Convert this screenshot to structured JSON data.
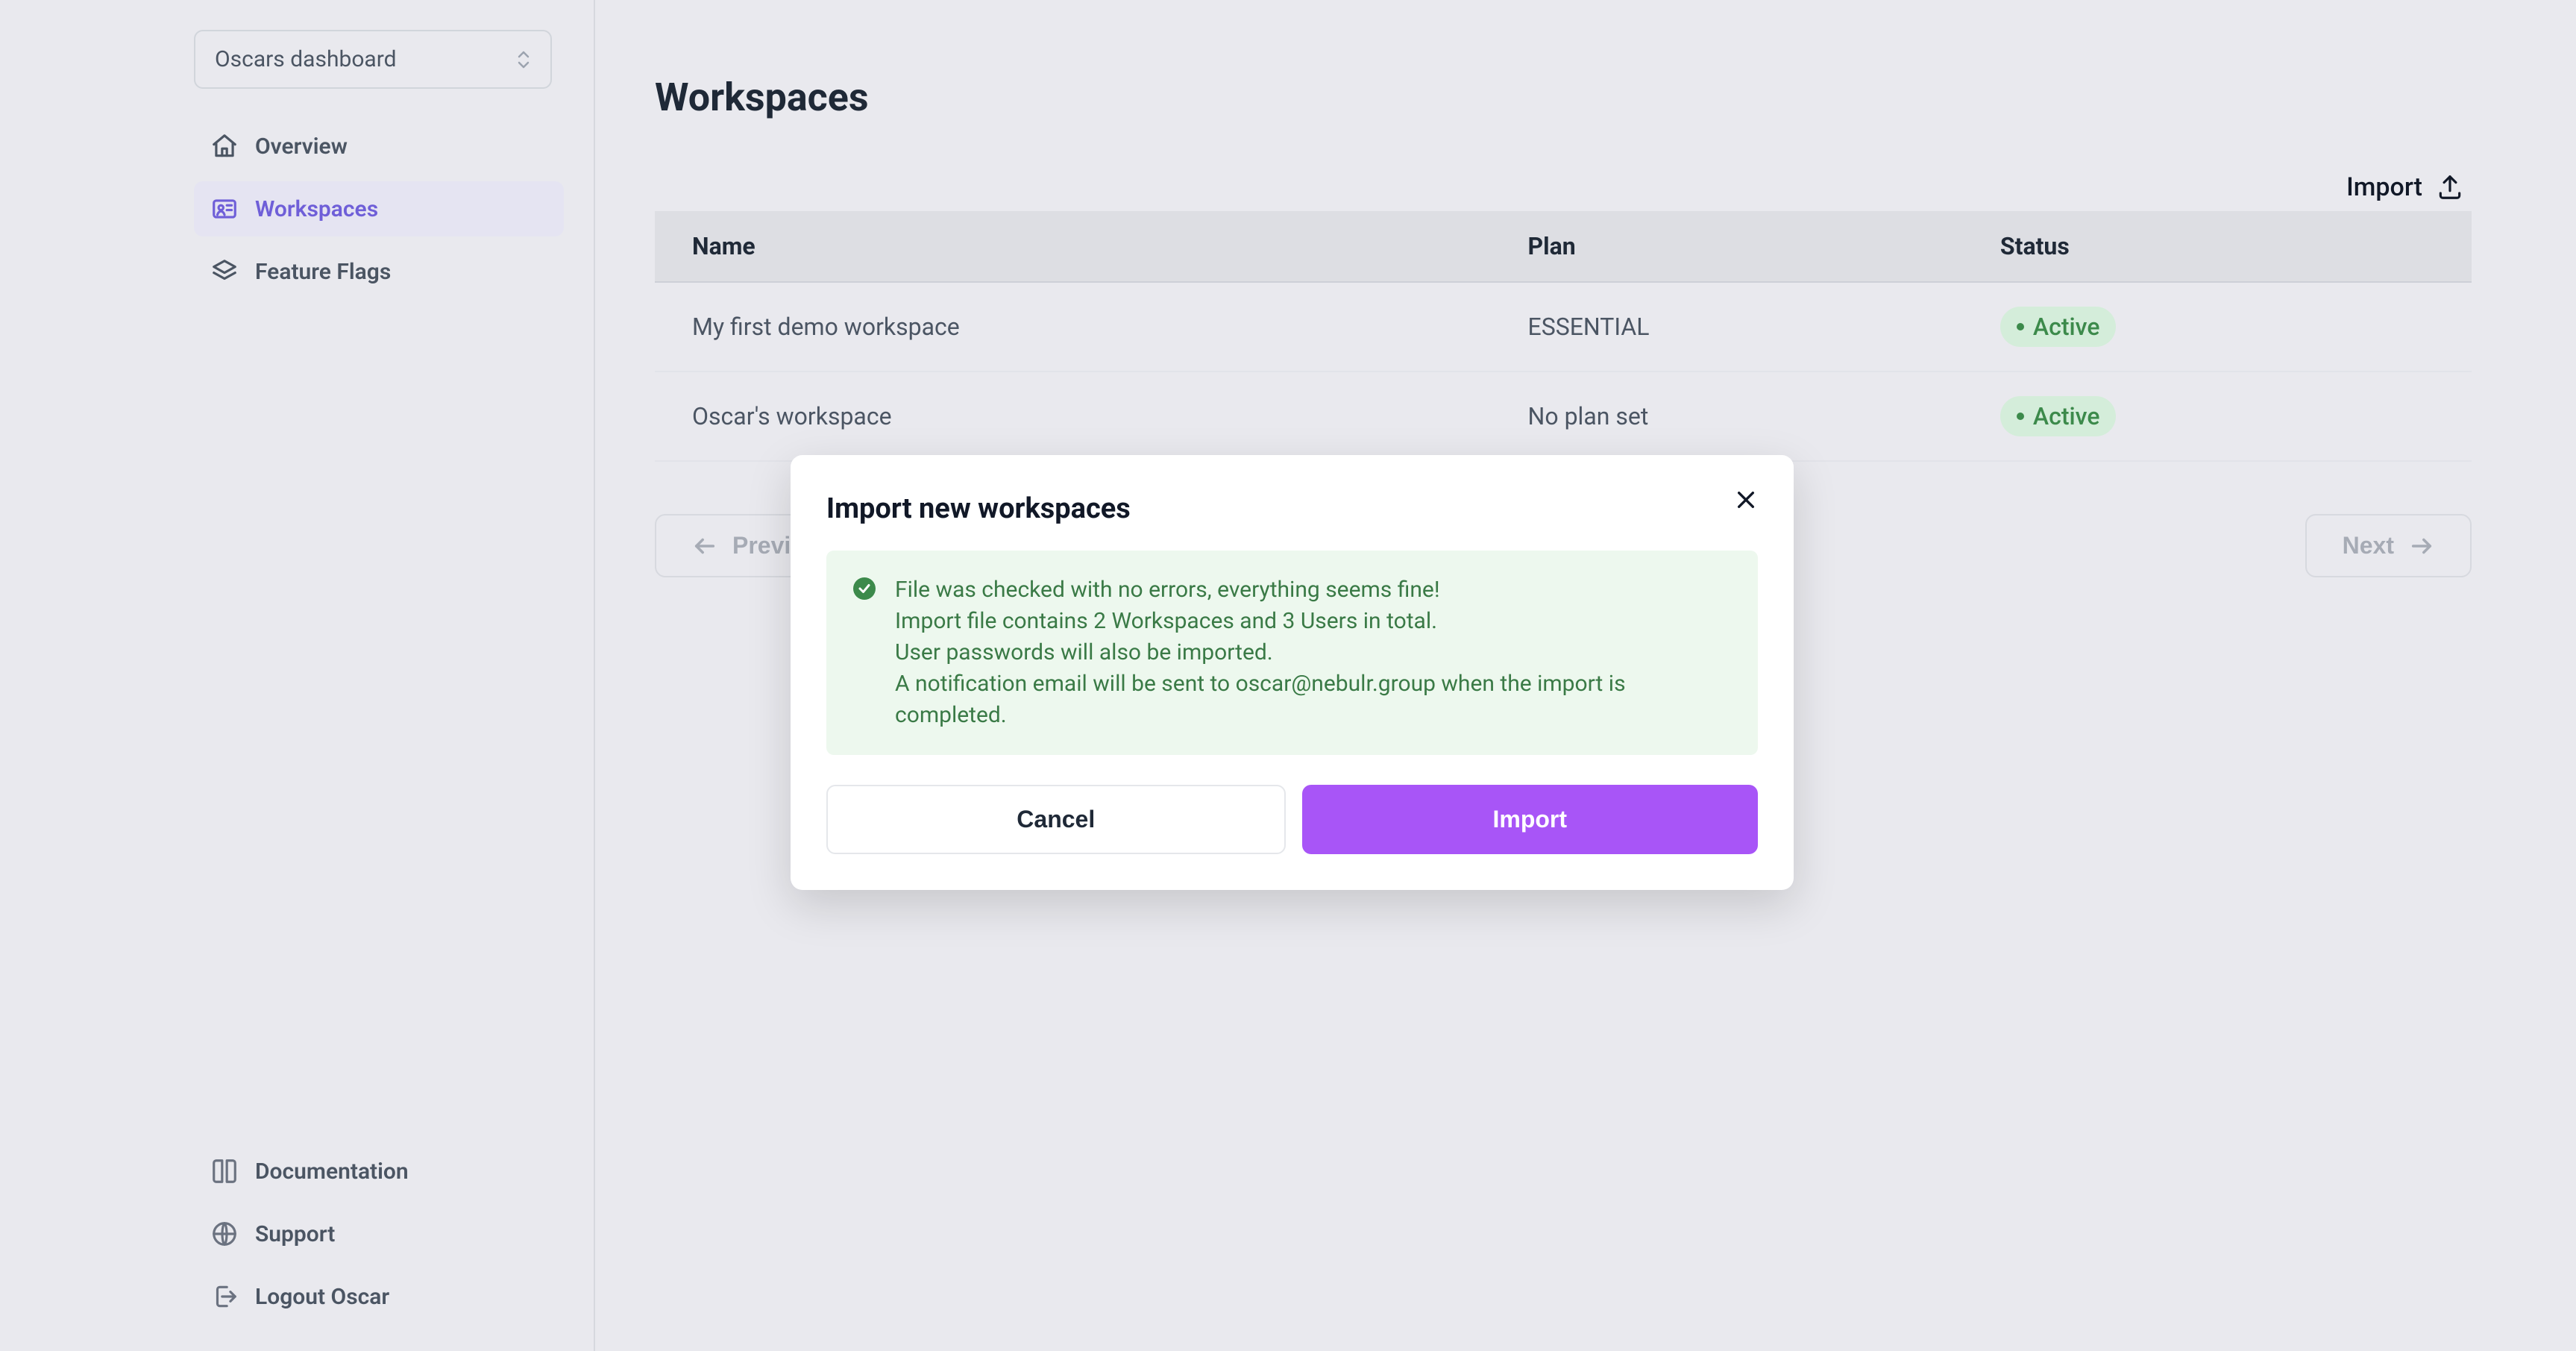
{
  "sidebar": {
    "dashboard_selector": "Oscars dashboard",
    "nav": {
      "overview": "Overview",
      "workspaces": "Workspaces",
      "feature_flags": "Feature Flags"
    },
    "bottom": {
      "documentation": "Documentation",
      "support": "Support",
      "logout": "Logout Oscar"
    }
  },
  "main": {
    "title": "Workspaces",
    "import_label": "Import",
    "table": {
      "columns": {
        "name": "Name",
        "plan": "Plan",
        "status": "Status"
      },
      "rows": [
        {
          "name": "My first demo workspace",
          "plan": "ESSENTIAL",
          "status": "Active"
        },
        {
          "name": "Oscar's workspace",
          "plan": "No plan set",
          "status": "Active"
        }
      ]
    },
    "pager": {
      "prev": "Previous",
      "next": "Next"
    }
  },
  "modal": {
    "title": "Import new workspaces",
    "success_lines": [
      "File was checked with no errors, everything seems fine!",
      "Import file contains 2 Workspaces and 3 Users in total.",
      "User passwords will also be imported.",
      "A notification email will be sent to oscar@nebulr.group when the import is completed."
    ],
    "cancel": "Cancel",
    "import": "Import"
  }
}
